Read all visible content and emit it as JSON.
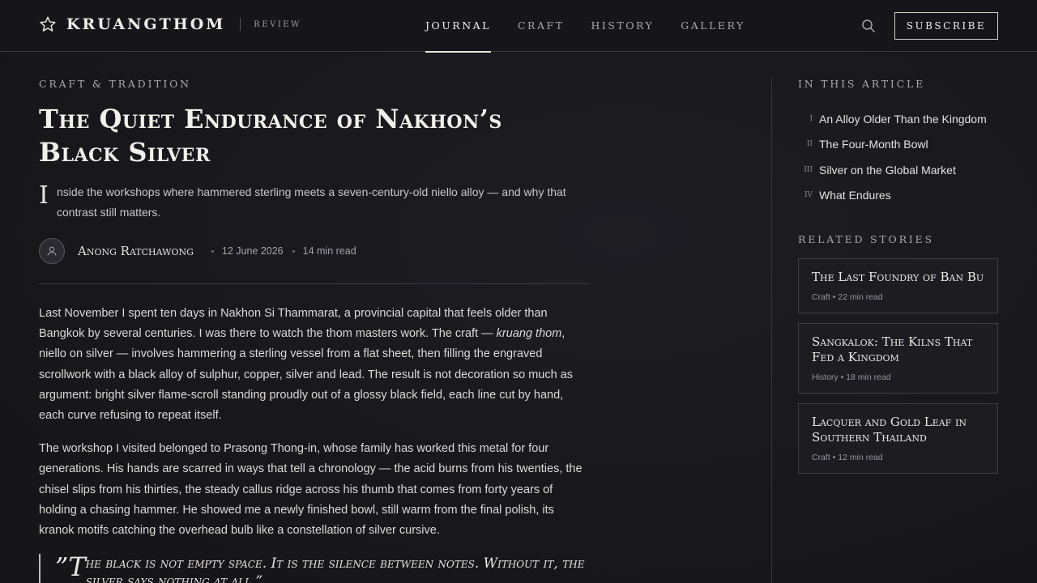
{
  "header": {
    "brand": "KRUANGTHOM",
    "brand_sub": "REVIEW",
    "nav": [
      {
        "label": "JOURNAL",
        "active": true
      },
      {
        "label": "CRAFT",
        "active": false
      },
      {
        "label": "HISTORY",
        "active": false
      },
      {
        "label": "GALLERY",
        "active": false
      }
    ],
    "subscribe_label": "SUBSCRIBE",
    "icons": {
      "logo": "star-icon",
      "search": "search-icon"
    }
  },
  "article": {
    "kicker": "Craft & Tradition",
    "title": "The Quiet Endurance of Nakhon’s Black Silver",
    "dek_initial": "I",
    "dek_rest": "nside the workshops where hammered sterling meets a seven-century-old niello alloy — and why that contrast still matters.",
    "author": "Anong Ratchawong",
    "date": "12 June 2026",
    "read_time": "14 min read",
    "p1_a": "Last November I spent ten days in Nakhon Si Thammarat, a provincial capital that feels older than Bangkok by several centuries. I was there to watch the thom masters work. The craft — ",
    "p1_em": "kruang thom",
    "p1_b": ", niello on silver — involves hammering a sterling vessel from a flat sheet, then filling the engraved scrollwork with a black alloy of sulphur, copper, silver and lead. The result is not decoration so much as argument: bright silver flame-scroll standing proudly out of a glossy black field, each line cut by hand, each curve refusing to repeat itself.",
    "p2": "The workshop I visited belonged to Prasong Thong-in, whose family has worked this metal for four generations. His hands are scarred in ways that tell a chronology — the acid burns from his twenties, the chisel slips from his thirties, the steady callus ridge across his thumb that comes from forty years of holding a chasing hammer. He showed me a newly finished bowl, still warm from the final polish, its kranok motifs catching the overhead bulb like a constellation of silver cursive.",
    "quote_open": "”T",
    "quote_text": "he black is not empty space. It is the silence between notes. Without it, the silver says nothing at all.”"
  },
  "sidebar": {
    "toc_heading": "In this article",
    "toc": [
      {
        "num": "I",
        "label": "An Alloy Older Than the Kingdom"
      },
      {
        "num": "II",
        "label": "The Four-Month Bowl"
      },
      {
        "num": "III",
        "label": "Silver on the Global Market"
      },
      {
        "num": "IV",
        "label": "What Endures"
      }
    ],
    "related_heading": "Related stories",
    "related": [
      {
        "title": "The Last Foundry of Ban Bu",
        "meta": "Craft • 22 min read"
      },
      {
        "title": "Sangkalok: The Kilns That Fed a Kingdom",
        "meta": "History • 18 min read"
      },
      {
        "title": "Lacquer and Gold Leaf in Southern Thailand",
        "meta": "Craft • 12 min read"
      }
    ]
  }
}
